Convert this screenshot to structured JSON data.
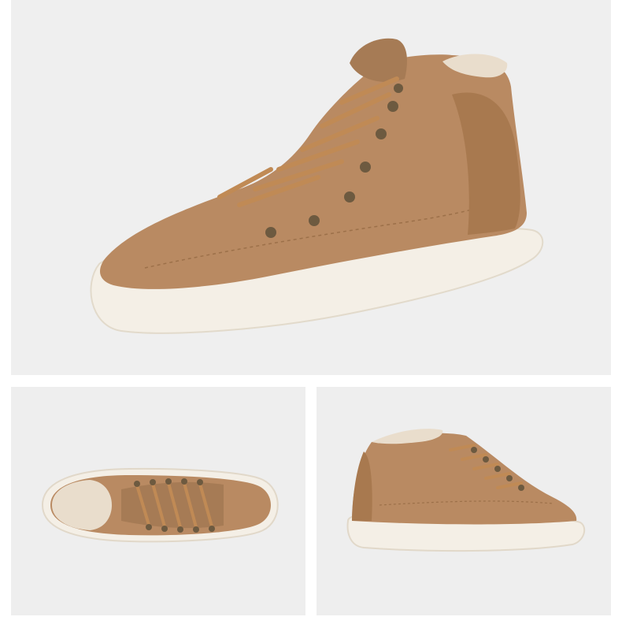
{
  "color_option": {
    "label": "栗色",
    "swatch_color": "#a9785a"
  },
  "colors": {
    "suede": "#b98a62",
    "suede_dark": "#9c7049",
    "sole": "#f4efe6",
    "lace": "#c08a55",
    "eyelet": "#6d5a40"
  }
}
